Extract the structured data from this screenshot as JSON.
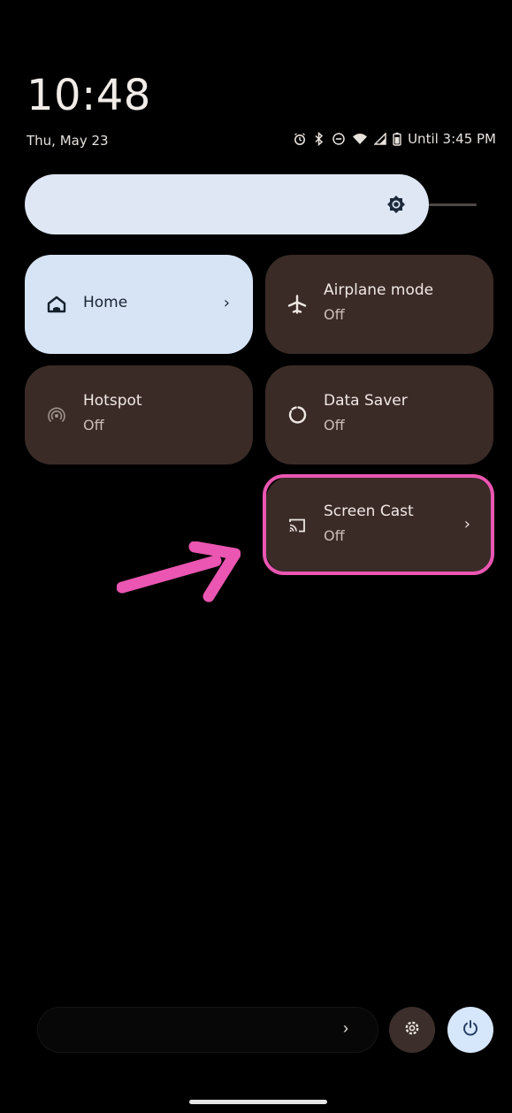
{
  "status": {
    "time": "10:48",
    "date": "Thu, May 23",
    "battery_text": "Until 3:45 PM",
    "icons": [
      "alarm-icon",
      "bluetooth-icon",
      "dnd-icon",
      "wifi-icon",
      "signal-icon",
      "battery-icon"
    ]
  },
  "brightness": {
    "icon": "brightness-icon"
  },
  "tiles": {
    "home": {
      "title": "Home",
      "icon": "home-icon",
      "chevron": "›"
    },
    "airplane": {
      "title": "Airplane mode",
      "sub": "Off",
      "icon": "airplane-icon"
    },
    "hotspot": {
      "title": "Hotspot",
      "sub": "Off",
      "icon": "hotspot-icon"
    },
    "datasaver": {
      "title": "Data Saver",
      "sub": "Off",
      "icon": "data-saver-icon"
    },
    "screencast": {
      "title": "Screen Cast",
      "sub": "Off",
      "icon": "cast-icon",
      "chevron": "›"
    }
  },
  "footer": {
    "chevron": "›",
    "settings_icon": "gear-icon",
    "power_icon": "power-icon"
  },
  "colors": {
    "highlight": "#ea56b1",
    "tile_active": "#d7e4f6",
    "tile_inactive": "#3a2b27"
  }
}
